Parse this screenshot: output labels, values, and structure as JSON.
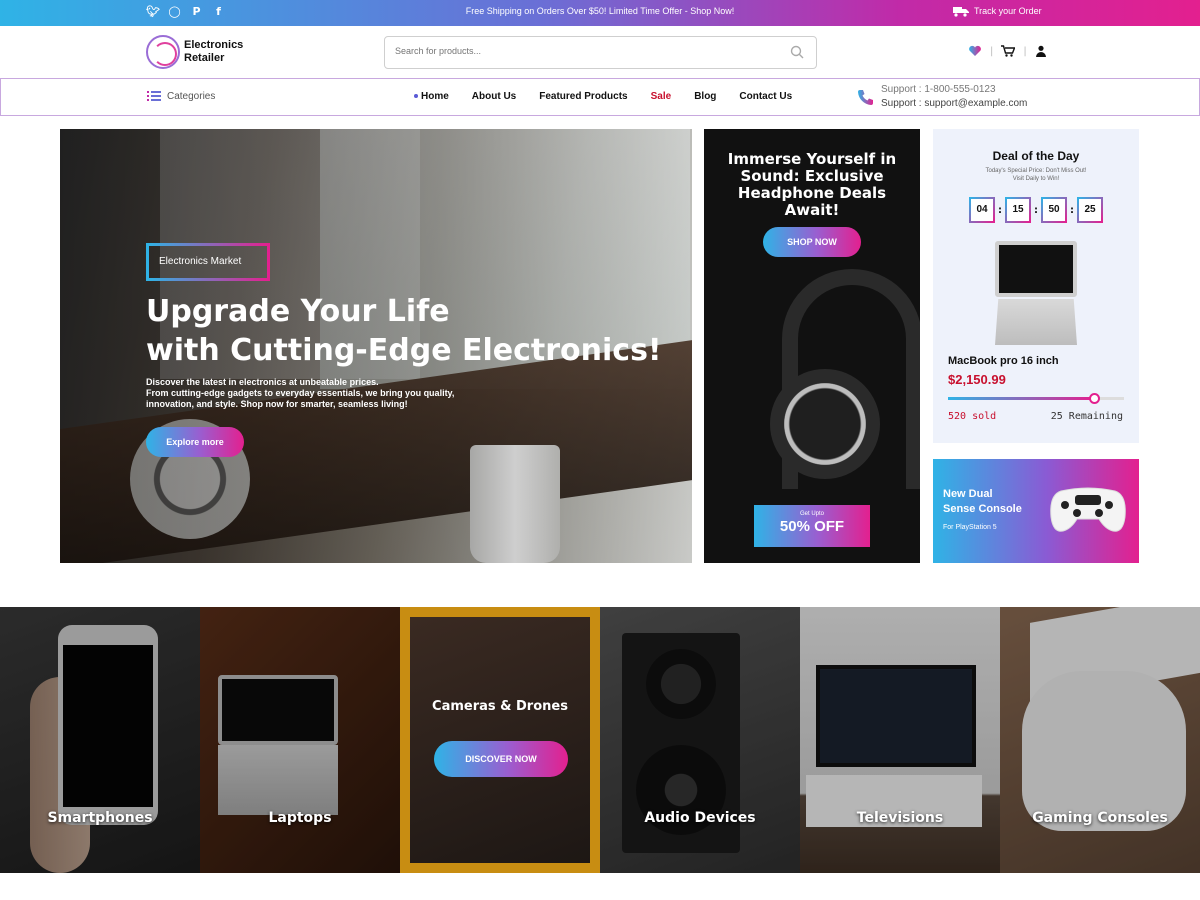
{
  "topbar": {
    "social": [
      "twitter",
      "instagram",
      "pinterest",
      "facebook"
    ],
    "promo": "Free Shipping on Orders Over $50! Limited Time Offer - Shop Now!",
    "track": "Track your Order"
  },
  "header": {
    "logo_line1": "Electronics",
    "logo_line2": "Retailer",
    "search_placeholder": "Search for products..."
  },
  "nav": {
    "categories": "Categories",
    "links": [
      "Home",
      "About Us",
      "Featured Products",
      "Sale",
      "Blog",
      "Contact Us"
    ],
    "support_phone": "Support : 1-800-555-0123",
    "support_email": "Support : support@example.com"
  },
  "hero": {
    "tag": "Electronics Market",
    "title_line1": "Upgrade Your Life",
    "title_line2": "with Cutting-Edge Electronics!",
    "desc_line1": "Discover the latest in electronics at unbeatable prices.",
    "desc_line2": "From cutting-edge gadgets to everyday essentials, we bring you quality,",
    "desc_line3": "innovation, and style. Shop now for smarter, seamless living!",
    "cta": "Explore more"
  },
  "headphones": {
    "title_line1": "Immerse Yourself in",
    "title_line2": "Sound: Exclusive",
    "title_line3": "Headphone Deals",
    "title_line4": "Await!",
    "shop": "SHOP NOW",
    "upto": "Get Upto",
    "off": "50% OFF"
  },
  "deal": {
    "title": "Deal of the Day",
    "sub_line1": "Today's Special Price: Don't Miss Out!",
    "sub_line2": "Visit Daily to Win!",
    "timer": [
      "04",
      "15",
      "50",
      "25"
    ],
    "product": "MacBook pro 16 inch",
    "price": "$2,150.99",
    "sold": "520 sold",
    "remaining": "25 Remaining",
    "sold_fraction": 0.83
  },
  "console": {
    "title_line1": "New Dual",
    "title_line2": "Sense Console",
    "sub": "For PlayStation 5"
  },
  "categories": {
    "items": [
      "Smartphones",
      "Laptops",
      "Cameras & Drones",
      "Audio Devices",
      "Televisions",
      "Gaming Consoles"
    ],
    "discover": "DISCOVER NOW"
  },
  "colors": {
    "accent_start": "#2fb3e6",
    "accent_end": "#e3208f",
    "sale": "#c8102e"
  }
}
